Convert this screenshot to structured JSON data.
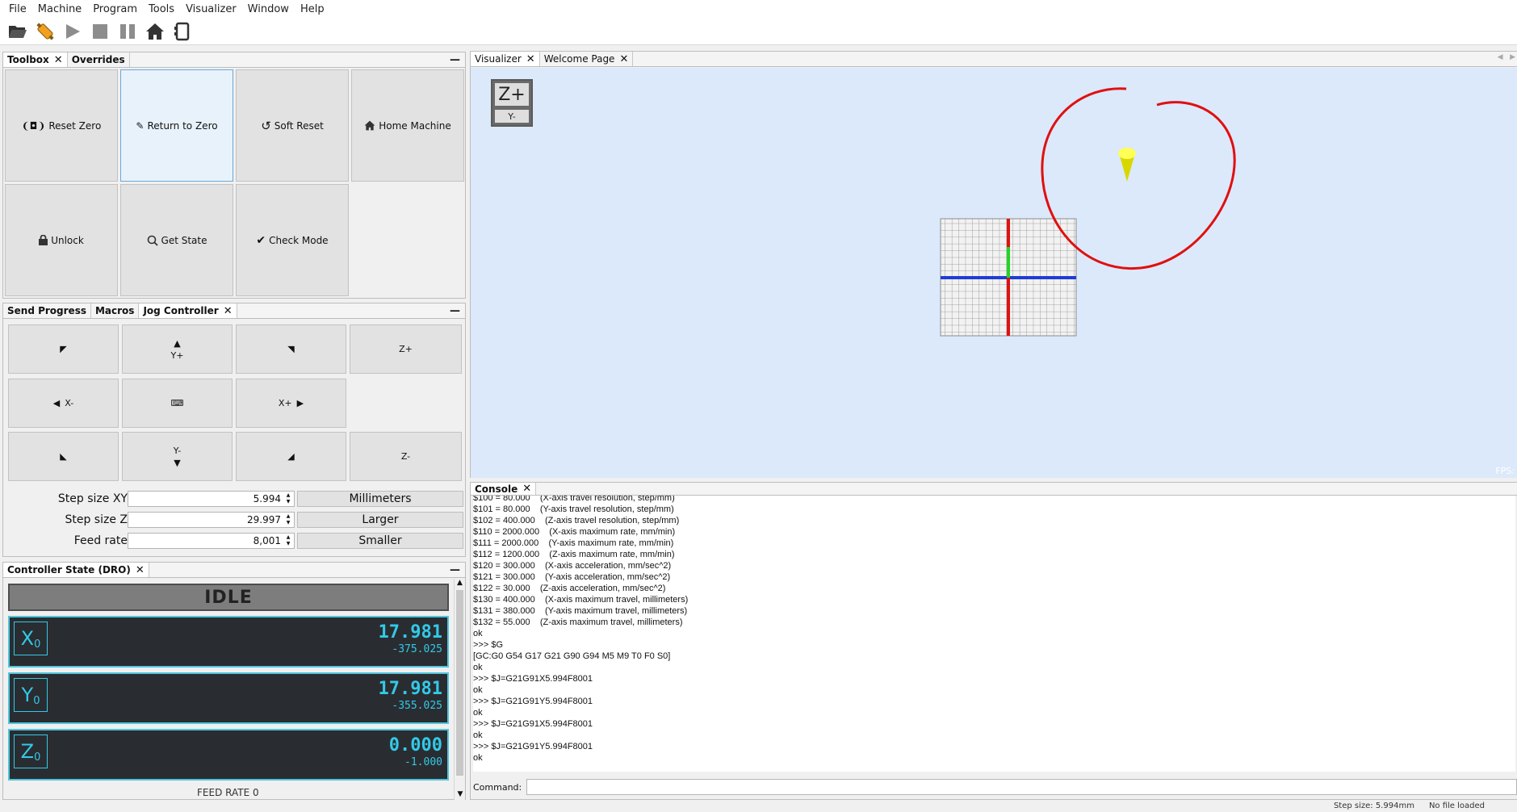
{
  "menu": [
    "File",
    "Machine",
    "Program",
    "Tools",
    "Visualizer",
    "Window",
    "Help"
  ],
  "toolbar_icons": [
    "folder-open-icon",
    "connect-icon",
    "play-icon",
    "stop-icon",
    "pause-icon",
    "home-icon",
    "device-icon"
  ],
  "toolbox": {
    "tabs": [
      {
        "label": "Toolbox",
        "closable": true
      },
      {
        "label": "Overrides",
        "closable": false
      }
    ],
    "buttons": [
      "Reset Zero",
      "Return to Zero",
      "Soft Reset",
      "Home Machine",
      "Unlock",
      "Get State",
      "Check Mode"
    ]
  },
  "jog": {
    "tabs": [
      {
        "label": "Send Progress",
        "closable": false
      },
      {
        "label": "Macros",
        "closable": false
      },
      {
        "label": "Jog Controller",
        "closable": true
      }
    ],
    "labels": {
      "y_plus": "Y+",
      "z_plus": "Z+",
      "x_minus": "X-",
      "x_plus": "X+",
      "y_minus": "Y-",
      "z_minus": "Z-"
    },
    "step_xy_label": "Step size XY",
    "step_xy_value": "5.994",
    "step_z_label": "Step size Z",
    "step_z_value": "29.997",
    "feed_label": "Feed rate",
    "feed_value": "8,001",
    "units_button": "Millimeters",
    "larger_button": "Larger",
    "smaller_button": "Smaller"
  },
  "dro": {
    "tab": "Controller State (DRO)",
    "state": "IDLE",
    "axes": [
      {
        "name": "X",
        "sub": "0",
        "work": "17.981",
        "machine": "-375.025"
      },
      {
        "name": "Y",
        "sub": "0",
        "work": "17.981",
        "machine": "-355.025"
      },
      {
        "name": "Z",
        "sub": "0",
        "work": "0.000",
        "machine": "-1.000"
      }
    ],
    "feed_rate_label": "FEED RATE",
    "feed_rate_value": "0"
  },
  "visualizer": {
    "tabs": [
      {
        "label": "Visualizer",
        "closable": true
      },
      {
        "label": "Welcome Page",
        "closable": true
      }
    ],
    "cube_top": "Z+",
    "cube_bottom": "Y-",
    "fps_label": "FPS:",
    "annotation_color": "#e01010"
  },
  "console": {
    "tab": "Console",
    "lines": [
      "$100 = 80.000    (X-axis travel resolution, step/mm)",
      "$101 = 80.000    (Y-axis travel resolution, step/mm)",
      "$102 = 400.000    (Z-axis travel resolution, step/mm)",
      "$110 = 2000.000    (X-axis maximum rate, mm/min)",
      "$111 = 2000.000    (Y-axis maximum rate, mm/min)",
      "$112 = 1200.000    (Z-axis maximum rate, mm/min)",
      "$120 = 300.000    (X-axis acceleration, mm/sec^2)",
      "$121 = 300.000    (Y-axis acceleration, mm/sec^2)",
      "$122 = 30.000    (Z-axis acceleration, mm/sec^2)",
      "$130 = 400.000    (X-axis maximum travel, millimeters)",
      "$131 = 380.000    (Y-axis maximum travel, millimeters)",
      "$132 = 55.000    (Z-axis maximum travel, millimeters)",
      "ok",
      ">>> $G",
      "[GC:G0 G54 G17 G21 G90 G94 M5 M9 T0 F0 S0]",
      "ok",
      ">>> $J=G21G91X5.994F8001",
      "ok",
      ">>> $J=G21G91Y5.994F8001",
      "ok",
      ">>> $J=G21G91X5.994F8001",
      "ok",
      ">>> $J=G21G91Y5.994F8001",
      "ok"
    ],
    "command_label": "Command:"
  },
  "status": {
    "step_size": "Step size: 5.994mm",
    "file": "No file loaded"
  }
}
